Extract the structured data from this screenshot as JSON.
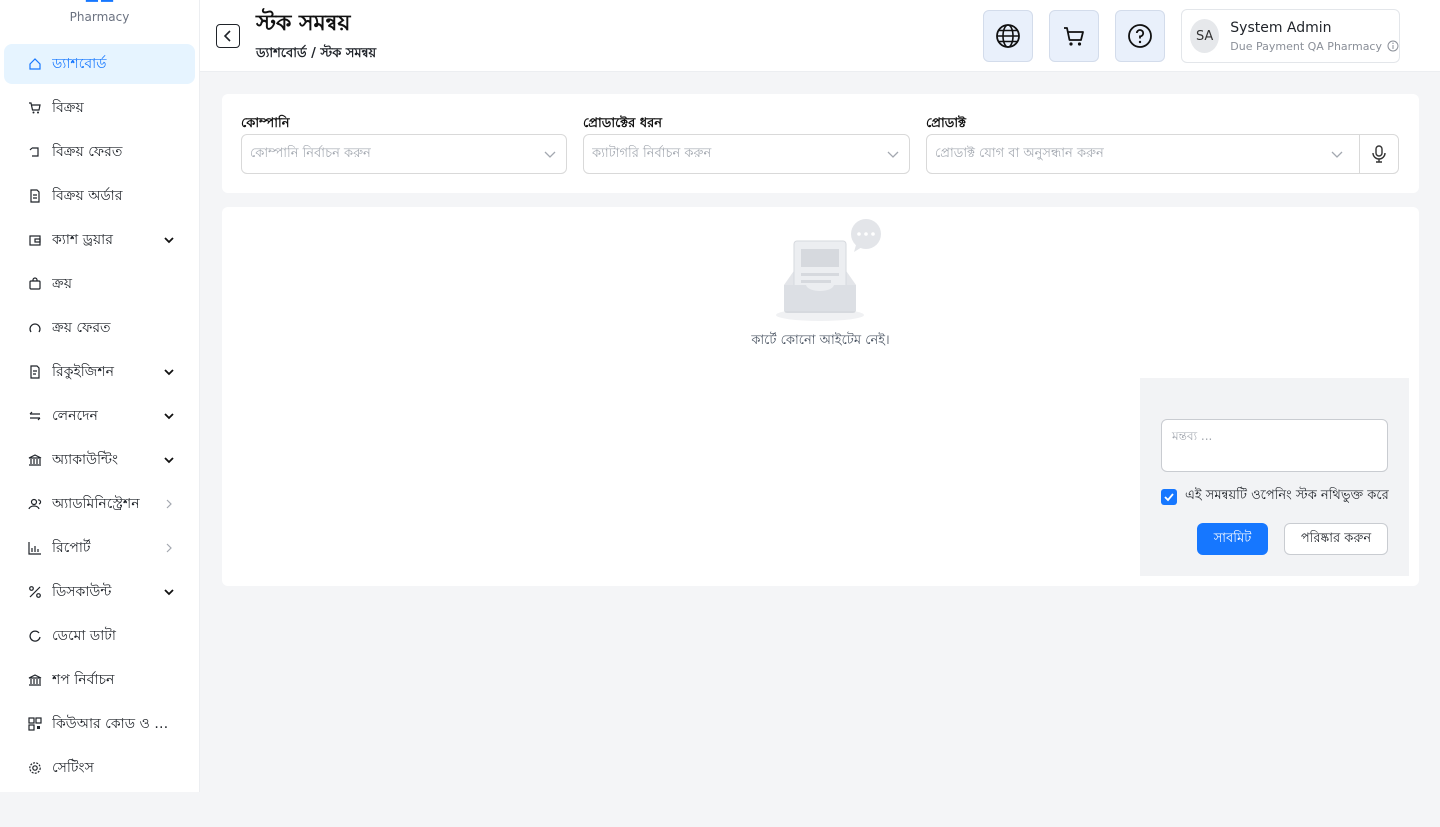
{
  "brand": {
    "subtitle": "Pharmacy"
  },
  "sidebar": {
    "items": [
      {
        "label": "ড্যাশবোর্ড",
        "icon": "home-icon",
        "active": true,
        "caret": ""
      },
      {
        "label": "বিক্রয়",
        "icon": "cart-icon",
        "caret": ""
      },
      {
        "label": "বিক্রয় ফেরত",
        "icon": "return-icon",
        "caret": ""
      },
      {
        "label": "বিক্রয় অর্ডার",
        "icon": "document-icon",
        "caret": ""
      },
      {
        "label": "ক্যাশ ড্রয়ার",
        "icon": "wallet-icon",
        "caret": "down"
      },
      {
        "label": "ক্রয়",
        "icon": "bag-icon",
        "caret": ""
      },
      {
        "label": "ক্রয় ফেরত",
        "icon": "undo-icon",
        "caret": ""
      },
      {
        "label": "রিকুইজিশন",
        "icon": "file-icon",
        "caret": "down"
      },
      {
        "label": "লেনদেন",
        "icon": "swap-icon",
        "caret": "down"
      },
      {
        "label": "অ্যাকাউন্টিং",
        "icon": "bank-icon",
        "caret": "down"
      },
      {
        "label": "অ্যাডমিনিস্ট্রেশন",
        "icon": "users-icon",
        "caret": "right"
      },
      {
        "label": "রিপোর্ট",
        "icon": "bar-chart-icon",
        "caret": "right"
      },
      {
        "label": "ডিসকাউন্ট",
        "icon": "percent-icon",
        "caret": "down"
      },
      {
        "label": "ডেমো ডাটা",
        "icon": "reload-icon",
        "caret": ""
      },
      {
        "label": "শপ নির্বাচন",
        "icon": "shop-icon",
        "caret": ""
      },
      {
        "label": "কিউআর কোড ও মা...",
        "icon": "qrcode-icon",
        "caret": ""
      },
      {
        "label": "সেটিংস",
        "icon": "settings-icon",
        "caret": ""
      }
    ]
  },
  "header": {
    "title": "স্টক সমন্বয়",
    "breadcrumb": "ড্যাশবোর্ড / স্টক সমন্বয়",
    "user": {
      "initials": "SA",
      "name": "System Admin",
      "org": "Due Payment QA Pharmacy"
    }
  },
  "filters": {
    "company": {
      "label": "কোম্পানি",
      "placeholder": "কোম্পানি নির্বাচন করুন"
    },
    "category": {
      "label": "প্রোডাক্টের ধরন",
      "placeholder": "ক্যাটাগরি নির্বাচন করুন"
    },
    "product": {
      "label": "প্রোডাক্ট",
      "placeholder": "প্রোডাক্ট যোগ বা অনুসন্ধান করুন"
    }
  },
  "cart": {
    "empty_text": "কার্টে কোনো আইটেম নেই।",
    "note_placeholder": "মন্তব্য ...",
    "checkbox_label": "এই সমন্বয়টি ওপেনিং স্টক নথিভুক্ত করে",
    "checkbox_checked": true,
    "submit_label": "সাবমিট",
    "clear_label": "পরিষ্কার করুন"
  },
  "colors": {
    "primary": "#1677ff",
    "active_bg": "#e6f4ff"
  }
}
